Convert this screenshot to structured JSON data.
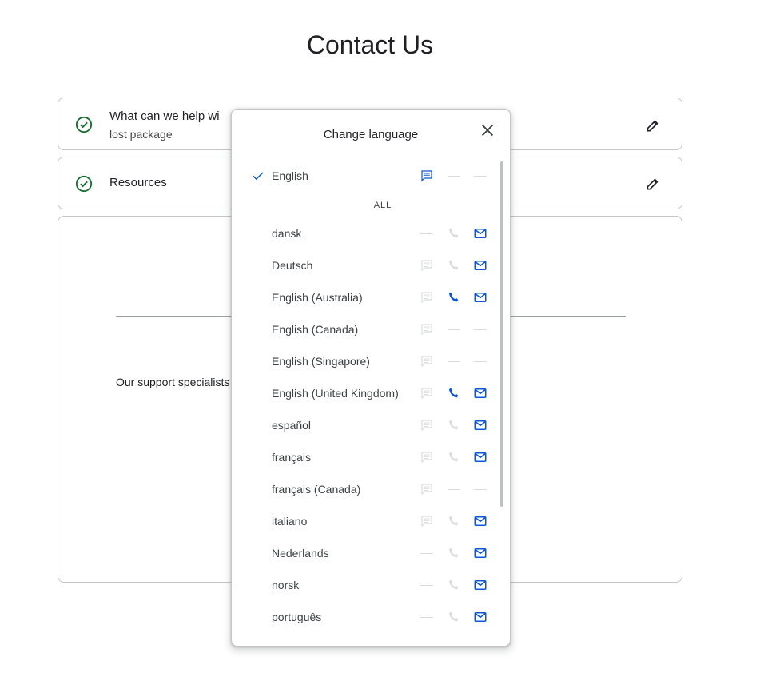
{
  "page": {
    "title": "Contact Us"
  },
  "steps": [
    {
      "title": "What can we help wi",
      "subtitle": "lost package"
    },
    {
      "title": "Resources"
    }
  ],
  "main": {
    "support_text": "Our support specialists"
  },
  "dialog": {
    "title": "Change language",
    "selected": {
      "name": "English",
      "chat": "available",
      "phone": "none",
      "email": "none"
    },
    "section_label": "ALL",
    "languages": [
      {
        "name": "dansk",
        "chat": "none",
        "phone": "unavailable",
        "email": "available"
      },
      {
        "name": "Deutsch",
        "chat": "unavailable",
        "phone": "unavailable",
        "email": "available"
      },
      {
        "name": "English (Australia)",
        "chat": "unavailable",
        "phone": "available",
        "email": "available"
      },
      {
        "name": "English (Canada)",
        "chat": "unavailable",
        "phone": "none",
        "email": "none"
      },
      {
        "name": "English (Singapore)",
        "chat": "unavailable",
        "phone": "none",
        "email": "none"
      },
      {
        "name": "English (United Kingdom)",
        "chat": "unavailable",
        "phone": "available",
        "email": "available"
      },
      {
        "name": "español",
        "chat": "unavailable",
        "phone": "unavailable",
        "email": "available"
      },
      {
        "name": "français",
        "chat": "unavailable",
        "phone": "unavailable",
        "email": "available"
      },
      {
        "name": "français (Canada)",
        "chat": "unavailable",
        "phone": "none",
        "email": "none"
      },
      {
        "name": "italiano",
        "chat": "unavailable",
        "phone": "unavailable",
        "email": "available"
      },
      {
        "name": "Nederlands",
        "chat": "none",
        "phone": "unavailable",
        "email": "available"
      },
      {
        "name": "norsk",
        "chat": "none",
        "phone": "unavailable",
        "email": "available"
      },
      {
        "name": "português",
        "chat": "none",
        "phone": "unavailable",
        "email": "available"
      }
    ]
  },
  "colors": {
    "accent_blue": "#0b57d0",
    "success_green": "#146c2e",
    "disabled_gray": "#dadce0",
    "text": "#202124"
  },
  "icons": {
    "step_status": "check-circle-icon",
    "edit": "pencil-icon",
    "close": "close-icon",
    "selected": "checkmark-icon",
    "chat": "chat-icon",
    "phone": "phone-icon",
    "email": "mail-icon"
  }
}
